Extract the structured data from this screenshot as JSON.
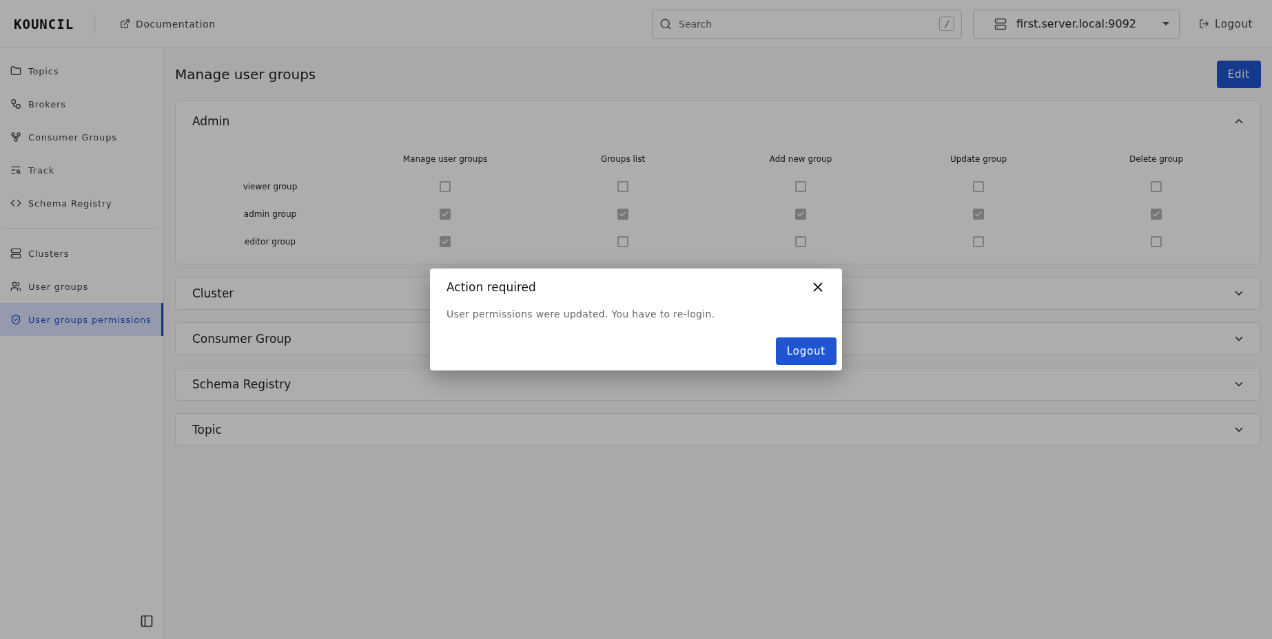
{
  "header": {
    "logo": "KOUNCIL",
    "documentation_link": "Documentation",
    "search": {
      "placeholder": "Search",
      "shortcut": "/"
    },
    "server_select": {
      "value": "first.server.local:9092"
    },
    "logout_button": "Logout"
  },
  "sidebar": {
    "sections": [
      {
        "items": [
          {
            "label": "Topics",
            "selected": false
          },
          {
            "label": "Brokers",
            "selected": false
          },
          {
            "label": "Consumer Groups",
            "selected": false
          },
          {
            "label": "Track",
            "selected": false
          },
          {
            "label": "Schema Registry",
            "selected": false
          }
        ]
      },
      {
        "items": [
          {
            "label": "Clusters",
            "selected": false
          },
          {
            "label": "User groups",
            "selected": false
          },
          {
            "label": "User groups permissions",
            "selected": true
          }
        ]
      }
    ]
  },
  "page": {
    "title": "Manage user groups",
    "edit_button": "Edit"
  },
  "panels": [
    {
      "title": "Admin",
      "expanded": true,
      "columns": [
        "Manage user groups",
        "Groups list",
        "Add new group",
        "Update group",
        "Delete group"
      ],
      "rows": [
        {
          "label": "viewer group",
          "permissions": [
            {
              "checked": false
            },
            {
              "checked": false
            },
            {
              "checked": false
            },
            {
              "checked": false
            },
            {
              "checked": false
            }
          ]
        },
        {
          "label": "admin group",
          "permissions": [
            {
              "checked": true
            },
            {
              "checked": true
            },
            {
              "checked": true
            },
            {
              "checked": true
            },
            {
              "checked": true
            }
          ]
        },
        {
          "label": "editor group",
          "permissions": [
            {
              "checked": true
            },
            {
              "checked": false
            },
            {
              "checked": false
            },
            {
              "checked": false
            },
            {
              "checked": false
            }
          ]
        }
      ]
    },
    {
      "title": "Cluster",
      "expanded": false
    },
    {
      "title": "Consumer Group",
      "expanded": false
    },
    {
      "title": "Schema Registry",
      "expanded": false
    },
    {
      "title": "Topic",
      "expanded": false
    }
  ],
  "dialog": {
    "title": "Action required",
    "message": "User permissions were updated. You have to re-login.",
    "button": "Logout"
  }
}
